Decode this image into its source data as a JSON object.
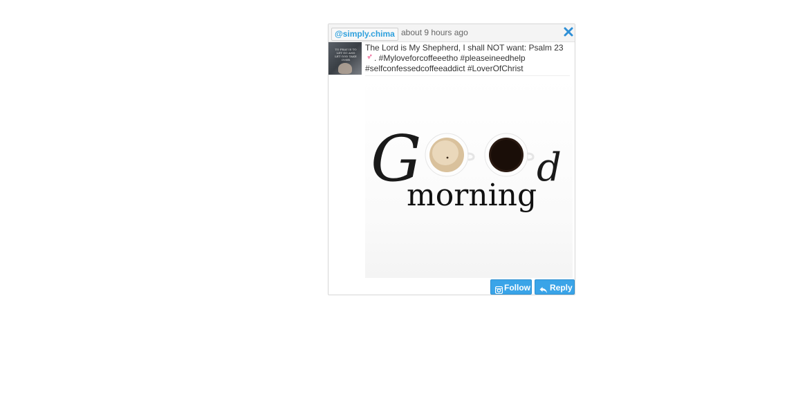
{
  "post": {
    "handle": "@simply.chima",
    "time_ago": "about 9 hours ago",
    "caption_line1": "The Lord is My Shepherd, I shall NOT want: Psalm 23",
    "caption_line2": ". #Myloveforcoffeeetho #pleaseineedhelp",
    "caption_line3": "#selfconfessedcoffeeaddict #LoverOfChrist",
    "caption_emoji": "two-hearts-icon",
    "avatar_text": "TO PRAY IS TO LET GO AND LET GOD TAKE OVER",
    "image_text_script": "G",
    "image_text_script_end": "d",
    "image_text_main": "morning"
  },
  "actions": {
    "follow_label": "Follow",
    "follow_icon": "instagram-icon",
    "reply_label": "Reply",
    "reply_icon": "reply-arrow-icon",
    "close_icon": "close-x-icon"
  },
  "colors": {
    "accent": "#3aa4e8",
    "handle": "#2ea0dd",
    "close": "#2e8fd6"
  }
}
